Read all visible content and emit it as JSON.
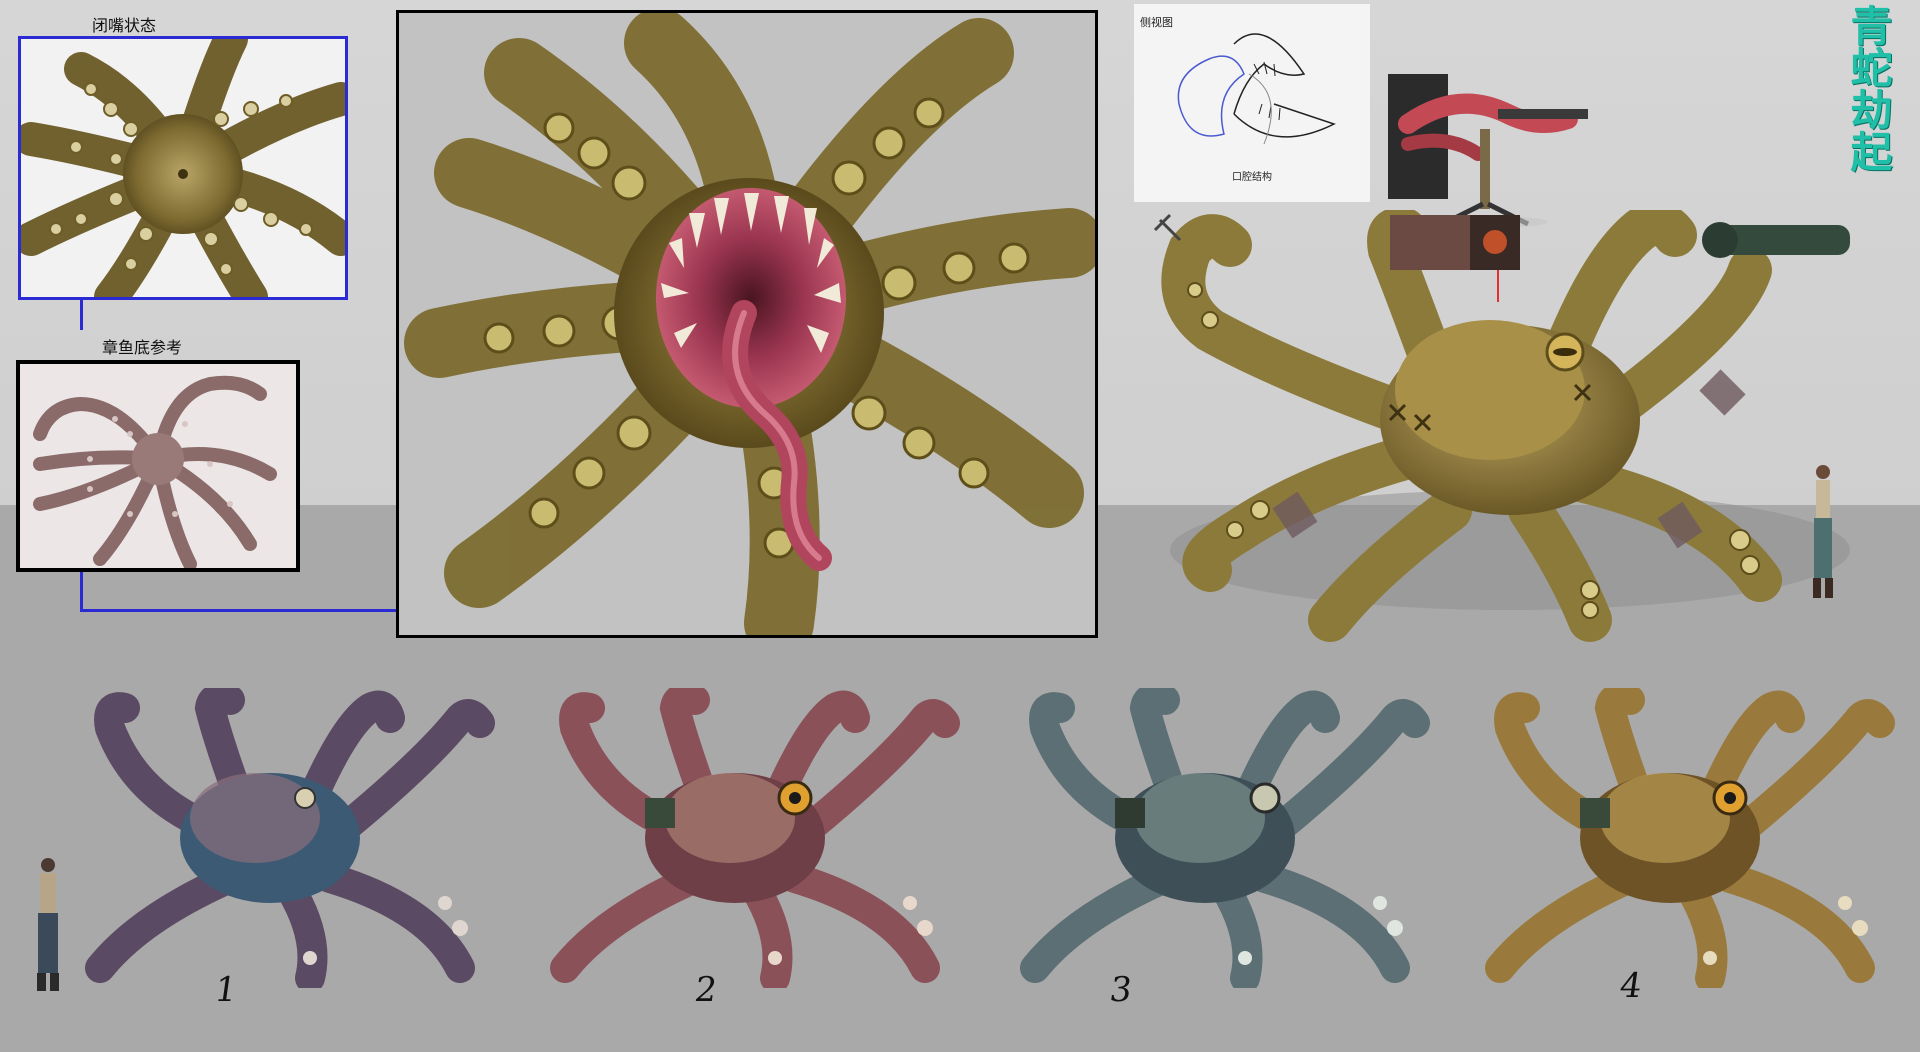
{
  "labels": {
    "closed_mouth": "闭嘴状态",
    "octopus_bottom_ref": "章鱼底参考",
    "side_view": "侧视图",
    "mouth_structure": "口腔结构"
  },
  "logo": {
    "text": "青蛇劫起",
    "color": "#1fbfa8"
  },
  "variants": [
    {
      "number": "1",
      "palette": [
        "#5b4a63",
        "#3d5a74",
        "#8a6e7c"
      ]
    },
    {
      "number": "2",
      "palette": [
        "#8a5158",
        "#b78a7c",
        "#6e3f47"
      ]
    },
    {
      "number": "3",
      "palette": [
        "#5b6f74",
        "#8aa39a",
        "#3f4f58"
      ]
    },
    {
      "number": "4",
      "palette": [
        "#9a7a3c",
        "#c7a65a",
        "#6e5326"
      ]
    }
  ],
  "colors": {
    "octopus_olive": "#8c7a3a",
    "mouth_pink": "#b0455d",
    "frame_blue": "#2b2bd6",
    "wall": "#d6d6d6",
    "floor": "#a9a9a9"
  }
}
